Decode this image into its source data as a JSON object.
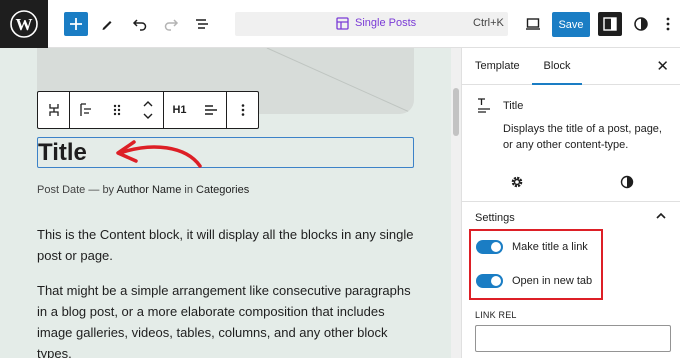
{
  "topbar": {
    "command_title": "Single Posts",
    "command_shortcut": "Ctrl+K",
    "save_label": "Save"
  },
  "canvas": {
    "toolbar": {
      "heading_level": "H1"
    },
    "title": "Title",
    "meta": {
      "date": "Post Date",
      "separator": "—",
      "by": "by",
      "author": "Author Name",
      "in": "in",
      "categories": "Categories"
    },
    "paragraphs": [
      "This is the Content block, it will display all the blocks in any single post or page.",
      "That might be a simple arrangement like consecutive paragraphs in a blog post, or a more elaborate composition that includes image galleries, videos, tables, columns, and any other block types."
    ],
    "annotation_color": "#dd1f26"
  },
  "sidebar": {
    "tabs": [
      "Template",
      "Block"
    ],
    "active_tab": "Block",
    "block_name": "Title",
    "block_description": "Displays the title of a post, page, or any other content-type.",
    "settings_heading": "Settings",
    "toggles": [
      {
        "label": "Make title a link",
        "on": true
      },
      {
        "label": "Open in new tab",
        "on": true
      }
    ],
    "link_rel_label": "LINK REL",
    "link_rel_value": ""
  },
  "colors": {
    "accent": "#1a7dc4",
    "command_title": "#7a3bd6",
    "canvas_bg": "#e4ece8",
    "highlight_box": "#dd1f26"
  }
}
